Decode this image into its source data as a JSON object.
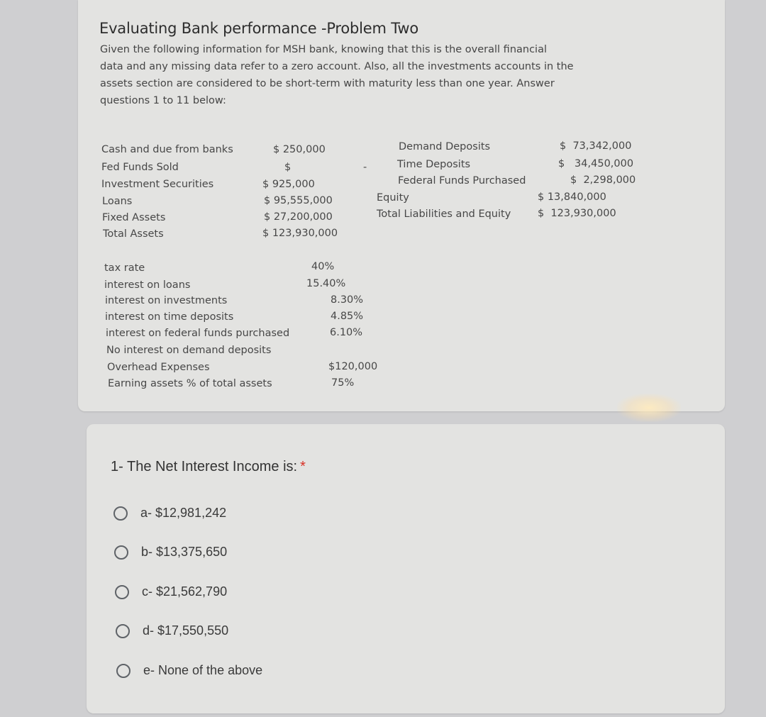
{
  "form": {
    "title": "Evaluating Bank performance -Problem Two",
    "description_lines": [
      "Given the following information for MSH bank, knowing that this is the overall financial",
      "data and any missing data refer to a zero account. Also, all the investments accounts in the",
      "assets section are considered to be short-term with maturity less than one year. Answer",
      "questions 1 to 11 below:"
    ],
    "assets": [
      {
        "label": "Cash and due from banks",
        "value": "$ 250,000"
      },
      {
        "label": "Fed Funds Sold",
        "value": "$"
      },
      {
        "label": "Investment Securities",
        "value": "$ 925,000"
      },
      {
        "label": "Loans",
        "value": "$ 95,555,000"
      },
      {
        "label": "Fixed Assets",
        "value": "$ 27,200,000"
      },
      {
        "label": "Total Assets",
        "value": "$ 123,930,000"
      }
    ],
    "fed_funds_dash": "-",
    "liabilities": [
      {
        "label": "Demand Deposits",
        "value": "$  73,342,000"
      },
      {
        "label": "Time Deposits",
        "value": "$   34,450,000"
      },
      {
        "label": "Federal Funds Purchased",
        "value": "$  2,298,000"
      },
      {
        "label": "Equity",
        "value": "$ 13,840,000"
      },
      {
        "label": "Total Liabilities and Equity",
        "value": "$  123,930,000"
      }
    ],
    "rates": [
      {
        "label": "tax rate",
        "value": "40%"
      },
      {
        "label": "interest on loans",
        "value": "15.40%"
      },
      {
        "label": "interest on investments",
        "value": "8.30%"
      },
      {
        "label": "interest on time deposits",
        "value": "4.85%"
      },
      {
        "label": "interest on federal funds purchased",
        "value": "6.10%"
      },
      {
        "label": "No interest on demand deposits",
        "value": ""
      },
      {
        "label": "Overhead Expenses",
        "value": "$120,000"
      },
      {
        "label": "Earning assets % of total assets",
        "value": "75%"
      }
    ]
  },
  "question1": {
    "title": "1- The Net Interest Income is:",
    "required_mark": "*",
    "options": [
      {
        "label": "a- $12,981,242",
        "selected": false
      },
      {
        "label": "b- $13,375,650",
        "selected": false
      },
      {
        "label": "c- $21,562,790",
        "selected": false
      },
      {
        "label": "d- $17,550,550",
        "selected": false
      },
      {
        "label": "e- None of the above",
        "selected": false
      }
    ]
  }
}
